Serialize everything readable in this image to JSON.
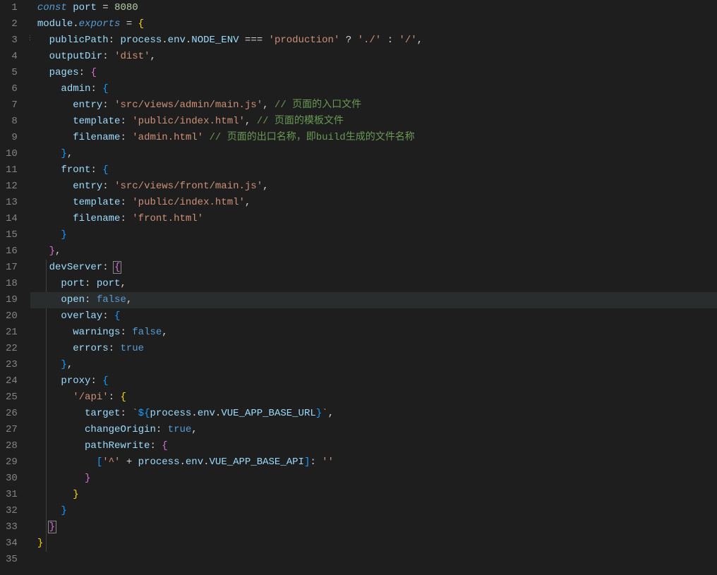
{
  "gutter": [
    "1",
    "2",
    "3",
    "4",
    "5",
    "6",
    "7",
    "8",
    "9",
    "10",
    "11",
    "12",
    "13",
    "14",
    "15",
    "16",
    "17",
    "18",
    "19",
    "20",
    "21",
    "22",
    "23",
    "24",
    "25",
    "26",
    "27",
    "28",
    "29",
    "30",
    "31",
    "32",
    "33",
    "34",
    "35"
  ],
  "highlightLine": 19,
  "tokens": {
    "l1": {
      "kw_const": "const",
      "var_port": "port",
      "op_eq": "=",
      "num": "8080"
    },
    "l2": {
      "var_module": "module",
      "punct_dot": ".",
      "prop_exports": "exports",
      "op_eq": "=",
      "brace": "{"
    },
    "l3": {
      "prop": "publicPath",
      "colon": ":",
      "v1": "process",
      "d1": ".",
      "v2": "env",
      "d2": ".",
      "v3": "NODE_ENV",
      "eq3": "===",
      "s1": "'production'",
      "q": "?",
      "s2": "'./'",
      "c": ":",
      "s3": "'/'",
      "comma": ","
    },
    "l4": {
      "prop": "outputDir",
      "colon": ":",
      "str": "'dist'",
      "comma": ","
    },
    "l5": {
      "prop": "pages",
      "colon": ":",
      "brace": "{"
    },
    "l6": {
      "prop": "admin",
      "colon": ":",
      "brace": "{"
    },
    "l7": {
      "prop": "entry",
      "colon": ":",
      "str": "'src/views/admin/main.js'",
      "comma": ",",
      "cmt": "// 页面的入口文件"
    },
    "l8": {
      "prop": "template",
      "colon": ":",
      "str": "'public/index.html'",
      "comma": ",",
      "cmt": "// 页面的模板文件"
    },
    "l9": {
      "prop": "filename",
      "colon": ":",
      "str": "'admin.html'",
      "cmt": "// 页面的出口名称，即build生成的文件名称"
    },
    "l10": {
      "brace": "}",
      "comma": ","
    },
    "l11": {
      "prop": "front",
      "colon": ":",
      "brace": "{"
    },
    "l12": {
      "prop": "entry",
      "colon": ":",
      "str": "'src/views/front/main.js'",
      "comma": ","
    },
    "l13": {
      "prop": "template",
      "colon": ":",
      "str": "'public/index.html'",
      "comma": ","
    },
    "l14": {
      "prop": "filename",
      "colon": ":",
      "str": "'front.html'"
    },
    "l15": {
      "brace": "}"
    },
    "l16": {
      "brace": "}",
      "comma": ","
    },
    "l17": {
      "prop": "devServer",
      "colon": ":",
      "brace": "{"
    },
    "l18": {
      "prop": "port",
      "colon": ":",
      "var": "port",
      "comma": ","
    },
    "l19": {
      "prop": "open",
      "colon": ":",
      "bool": "false",
      "comma": ","
    },
    "l20": {
      "prop": "overlay",
      "colon": ":",
      "brace": "{"
    },
    "l21": {
      "prop": "warnings",
      "colon": ":",
      "bool": "false",
      "comma": ","
    },
    "l22": {
      "prop": "errors",
      "colon": ":",
      "bool": "true"
    },
    "l23": {
      "brace": "}",
      "comma": ","
    },
    "l24": {
      "prop": "proxy",
      "colon": ":",
      "brace": "{"
    },
    "l25": {
      "str": "'/api'",
      "colon": ":",
      "brace": "{"
    },
    "l26": {
      "prop": "target",
      "colon": ":",
      "bt1": "`",
      "d1": "${",
      "v1": "process",
      "dot1": ".",
      "v2": "env",
      "dot2": ".",
      "v3": "VUE_APP_BASE_URL",
      "d2": "}",
      "bt2": "`",
      "comma": ","
    },
    "l27": {
      "prop": "changeOrigin",
      "colon": ":",
      "bool": "true",
      "comma": ","
    },
    "l28": {
      "prop": "pathRewrite",
      "colon": ":",
      "brace": "{"
    },
    "l29": {
      "lb": "[",
      "s1": "'^'",
      "plus": "+",
      "v1": "process",
      "d1": ".",
      "v2": "env",
      "d2": ".",
      "v3": "VUE_APP_BASE_API",
      "rb": "]",
      "colon": ":",
      "s2": "''"
    },
    "l30": {
      "brace": "}"
    },
    "l31": {
      "brace": "}"
    },
    "l32": {
      "brace": "}"
    },
    "l33": {
      "brace": "}"
    },
    "l34": {
      "brace": "}"
    }
  }
}
